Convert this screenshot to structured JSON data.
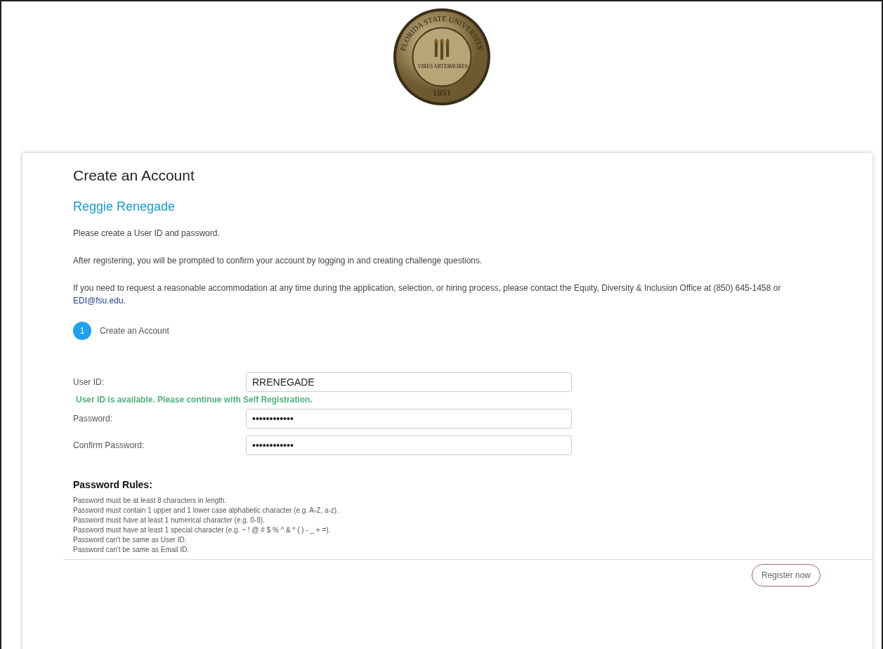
{
  "seal": {
    "ring_text": "FLORIDA STATE UNIVERSITY",
    "mottos": [
      "VIRES",
      "ARTES",
      "MORES"
    ],
    "year": "1851"
  },
  "card": {
    "title": "Create an Account",
    "name": "Reggie Renegade",
    "paragraphs": [
      "Please create a User ID and password.",
      "After registering, you will be prompted to confirm your account by logging in and creating challenge questions.",
      "If you need to request a reasonable accommodation at any time during the application, selection, or hiring process, please contact the Equity, Diversity & Inclusion Office at (850) 645-1458 or "
    ],
    "contact_link": "EDI@fsu.edu",
    "contact_end": ".",
    "steps": [
      {
        "number": "1",
        "label": "Create an Account",
        "selected": true
      }
    ],
    "fields": [
      {
        "label": "User ID:",
        "value": "RRENEGADE",
        "message": "User ID is available. Please continue with Self Registration."
      },
      {
        "label": "Password:",
        "value": "••••••••••••"
      },
      {
        "label": "Confirm Password:",
        "value": "••••••••••••"
      }
    ],
    "rules_title": "Password Rules:",
    "rules": [
      "Password must be at least 8 characters in length.",
      "Password must contain 1 upper and 1 lower case alphabetic character (e.g. A-Z, a-z).",
      "Password must have at least 1 numerical character (e.g. 0-9).",
      "Password must have at least 1 special character (e.g. ~ ! @ # $ % ^ & * ( ) - _ + =).",
      "Password can't be same as User ID.",
      "Password can't be same as Email ID."
    ],
    "button": "Register now"
  }
}
